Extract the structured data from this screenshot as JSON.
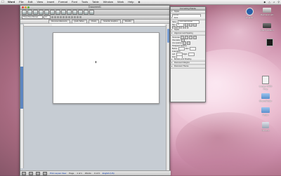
{
  "menubar": {
    "apple": "",
    "items": [
      "Word",
      "File",
      "Edit",
      "View",
      "Insert",
      "Format",
      "Font",
      "Tools",
      "Table",
      "Window",
      "Work",
      "Help"
    ],
    "right": [
      "",
      "",
      "",
      ""
    ]
  },
  "window": {
    "title": "Document1",
    "font_name": "Times New Roman",
    "gallery_tabs": [
      "Document Elements",
      "Quick Tables",
      "Charts",
      "SmartArt Graphics",
      "WordArt"
    ],
    "status": {
      "view": "Print Layout View",
      "page": "Page",
      "pages": "1 of 1",
      "words": "Words:",
      "words_value": "0 of 0",
      "language": "English (US)"
    }
  },
  "palette": {
    "title": "Formatting Palette",
    "style_label": "Name:",
    "style_value": "Normal",
    "font_label": "Name:",
    "font_value": "Times New Roman",
    "size_label": "Size:",
    "size_value": "12",
    "sections": [
      "Font",
      "Styles",
      "Alignment and Spacing",
      "Borders and Shading",
      "Document Margins",
      "Document Theme"
    ],
    "rows": [
      "Horizontal:",
      "Orientation:",
      "Line spacing:",
      "Paragraph Spacing:",
      "Before:",
      "After:",
      "Indentation:",
      "Left:",
      "Right:",
      "First:"
    ]
  },
  "desktop_icons": [
    {
      "label": "Pixelcar",
      "color": "#2a5fa8"
    },
    {
      "label": "Macintosh HD",
      "color": "#b7b7b7"
    },
    {
      "label": "Linux Partition",
      "color": "#4a4a4a"
    },
    {
      "label": "",
      "color": "#1a1a1a"
    },
    {
      "label": "Legacy UWM Prep",
      "color": "#e9e9e9"
    },
    {
      "label": "SharedFolder",
      "color": "#6aa0d8"
    },
    {
      "label": "Folder",
      "color": "#6aa0d8"
    },
    {
      "label": "Network",
      "color": "#c0c7d4"
    }
  ]
}
